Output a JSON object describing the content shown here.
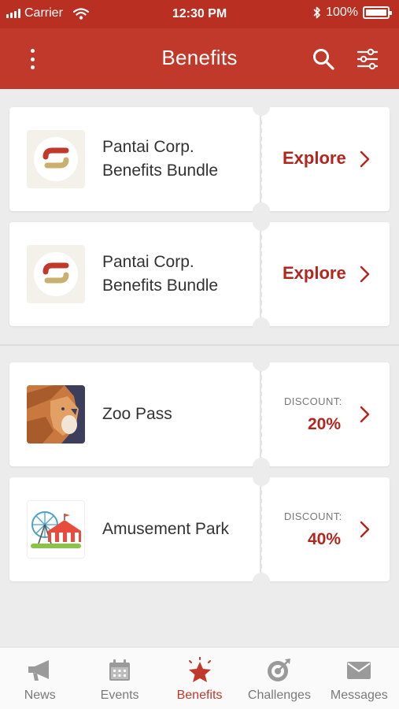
{
  "status_bar": {
    "carrier": "Carrier",
    "time": "12:30 PM",
    "battery": "100%"
  },
  "header": {
    "title": "Benefits"
  },
  "benefits": [
    {
      "name": "Pantai Corp. Benefits Bundle",
      "action": "Explore",
      "icon": "pantai-logo-icon"
    },
    {
      "name": "Pantai Corp. Benefits Bundle",
      "action": "Explore",
      "icon": "pantai-logo-icon"
    },
    {
      "name": "Zoo Pass",
      "discount_label": "DISCOUNT:",
      "discount_value": "20%",
      "icon": "lion-icon"
    },
    {
      "name": "Amusement Park",
      "discount_label": "DISCOUNT:",
      "discount_value": "40%",
      "icon": "ferris-wheel-icon"
    }
  ],
  "tabs": [
    {
      "label": "News",
      "icon": "megaphone-icon",
      "active": false
    },
    {
      "label": "Events",
      "icon": "calendar-icon",
      "active": false
    },
    {
      "label": "Benefits",
      "icon": "star-icon",
      "active": true
    },
    {
      "label": "Challenges",
      "icon": "target-icon",
      "active": false
    },
    {
      "label": "Messages",
      "icon": "envelope-icon",
      "active": false
    }
  ],
  "colors": {
    "primary": "#c0392b",
    "accent_text": "#b3261e",
    "background": "#ececec"
  }
}
